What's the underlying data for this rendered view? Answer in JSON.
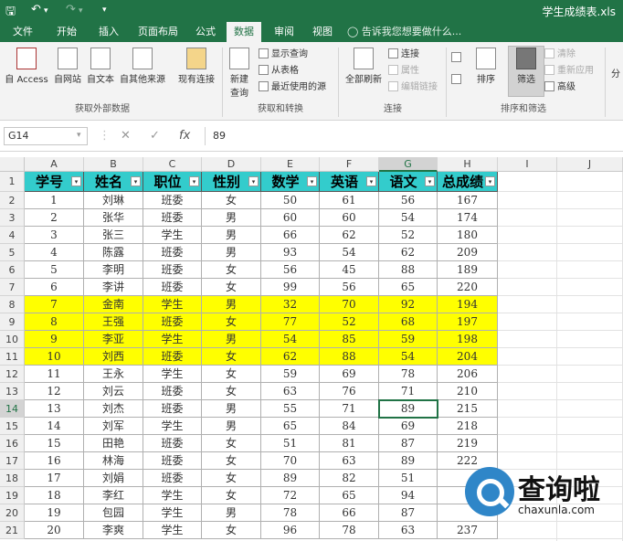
{
  "titlebar": {
    "title": "学生成绩表.xls",
    "save_icon": "save-icon",
    "undo_icon": "undo-icon",
    "redo_icon": "redo-icon"
  },
  "menu": {
    "tabs": [
      "文件",
      "开始",
      "插入",
      "页面布局",
      "公式",
      "数据",
      "审阅",
      "视图"
    ],
    "active_tab": "数据",
    "tell_me": "告诉我您想要做什么..."
  },
  "ribbon": {
    "from_access": "自 Access",
    "from_web": "自网站",
    "from_text": "自文本",
    "from_other": "自其他来源",
    "existing_conn": "现有连接",
    "group_external": "获取外部数据",
    "new_query": "新建",
    "new_query_2": "查询",
    "show_queries": "显示查询",
    "from_table": "从表格",
    "recent_sources": "最近使用的源",
    "group_transform": "获取和转换",
    "refresh_all": "全部刷新",
    "connections": "连接",
    "properties": "属性",
    "edit_links": "编辑链接",
    "group_connections": "连接",
    "sort": "排序",
    "filter": "筛选",
    "clear": "清除",
    "reapply": "重新应用",
    "advanced": "高级",
    "group_sort_filter": "排序和筛选",
    "more": "分"
  },
  "formula_bar": {
    "name_box": "G14",
    "value": "89"
  },
  "sheet": {
    "columns": [
      "A",
      "B",
      "C",
      "D",
      "E",
      "F",
      "G",
      "H",
      "I",
      "J"
    ],
    "selected_column": "G",
    "selected_row": "14",
    "headers": [
      "学号",
      "姓名",
      "职位",
      "性别",
      "数学",
      "英语",
      "语文",
      "总成绩"
    ],
    "row_numbers": [
      "1",
      "2",
      "3",
      "4",
      "5",
      "6",
      "7",
      "8",
      "9",
      "10",
      "11",
      "12",
      "13",
      "14",
      "15",
      "16",
      "17",
      "18",
      "19",
      "20",
      "21"
    ],
    "highlight_color": "#ffff00",
    "header_color": "#33cccc",
    "rows": [
      [
        "1",
        "刘琳",
        "班委",
        "女",
        "50",
        "61",
        "56",
        "167"
      ],
      [
        "2",
        "张华",
        "班委",
        "男",
        "60",
        "60",
        "54",
        "174"
      ],
      [
        "3",
        "张三",
        "学生",
        "男",
        "66",
        "62",
        "52",
        "180"
      ],
      [
        "4",
        "陈露",
        "班委",
        "男",
        "93",
        "54",
        "62",
        "209"
      ],
      [
        "5",
        "李明",
        "班委",
        "女",
        "56",
        "45",
        "88",
        "189"
      ],
      [
        "6",
        "李讲",
        "班委",
        "女",
        "99",
        "56",
        "65",
        "220"
      ],
      [
        "7",
        "金南",
        "学生",
        "男",
        "32",
        "70",
        "92",
        "194"
      ],
      [
        "8",
        "王强",
        "班委",
        "女",
        "77",
        "52",
        "68",
        "197"
      ],
      [
        "9",
        "李亚",
        "学生",
        "男",
        "54",
        "85",
        "59",
        "198"
      ],
      [
        "10",
        "刘西",
        "班委",
        "女",
        "62",
        "88",
        "54",
        "204"
      ],
      [
        "11",
        "王永",
        "学生",
        "女",
        "59",
        "69",
        "78",
        "206"
      ],
      [
        "12",
        "刘云",
        "班委",
        "女",
        "63",
        "76",
        "71",
        "210"
      ],
      [
        "13",
        "刘杰",
        "班委",
        "男",
        "55",
        "71",
        "89",
        "215"
      ],
      [
        "14",
        "刘军",
        "学生",
        "男",
        "65",
        "84",
        "69",
        "218"
      ],
      [
        "15",
        "田艳",
        "班委",
        "女",
        "51",
        "81",
        "87",
        "219"
      ],
      [
        "16",
        "林海",
        "班委",
        "女",
        "70",
        "63",
        "89",
        "222"
      ],
      [
        "17",
        "刘娟",
        "班委",
        "女",
        "89",
        "82",
        "51",
        ""
      ],
      [
        "18",
        "李红",
        "学生",
        "女",
        "72",
        "65",
        "94",
        ""
      ],
      [
        "19",
        "包园",
        "学生",
        "男",
        "78",
        "66",
        "87",
        ""
      ],
      [
        "20",
        "李爽",
        "学生",
        "女",
        "96",
        "78",
        "63",
        "237"
      ]
    ],
    "highlighted_rows": [
      7,
      8,
      9,
      10
    ]
  },
  "watermark": {
    "text": "查询啦",
    "url": "chaxunla.com"
  }
}
